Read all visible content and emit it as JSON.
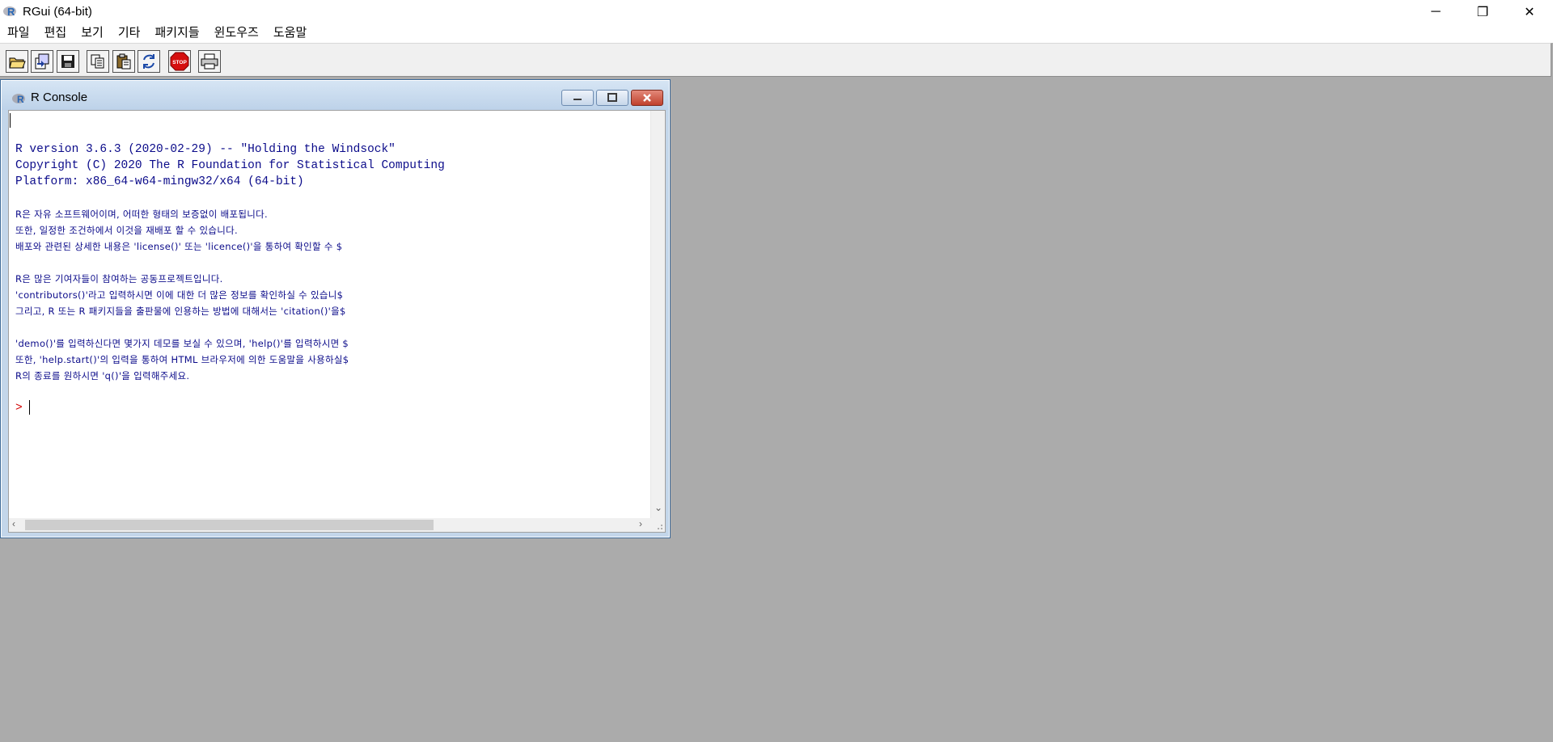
{
  "app": {
    "title": "RGui (64-bit)",
    "window_controls": {
      "minimize": "─",
      "restore": "❐",
      "close": "✕"
    }
  },
  "menu": [
    "파일",
    "편집",
    "보기",
    "기타",
    "패키지들",
    "윈도우즈",
    "도움말"
  ],
  "toolbar": {
    "buttons": [
      "open-script-icon",
      "load-workspace-icon",
      "save-workspace-icon",
      "copy-icon",
      "paste-icon",
      "copy-paste-icon",
      "stop-icon",
      "print-icon"
    ],
    "stop_label": "STOP"
  },
  "console": {
    "title": "R Console",
    "lines": [
      "R version 3.6.3 (2020-02-29) -- \"Holding the Windsock\"",
      "Copyright (C) 2020 The R Foundation for Statistical Computing",
      "Platform: x86_64-w64-mingw32/x64 (64-bit)",
      "R은 자유 소프트웨어이며, 어떠한 형태의 보증없이 배포됩니다.",
      "또한, 일정한 조건하에서 이것을 재배포 할 수 있습니다.",
      "배포와 관련된 상세한 내용은 'license()' 또는 'licence()'을 통하여 확인할 수 $",
      "R은 많은 기여자들이 참여하는 공동프로젝트입니다.",
      "'contributors()'라고 입력하시면 이에 대한 더 많은 정보를 확인하실 수 있습니$",
      "그리고, R 또는 R 패키지들을 출판물에 인용하는 방법에 대해서는 'citation()'을$",
      "'demo()'를 입력하신다면 몇가지 데모를 보실 수 있으며, 'help()'를 입력하시면 $",
      "또한, 'help.start()'의 입력을 통하여 HTML 브라우저에 의한 도움말을 사용하실$",
      "R의 종료를 원하시면 'q()'을 입력해주세요."
    ],
    "prompt": ">"
  },
  "colors": {
    "console_text": "#0b0b8a",
    "prompt": "#d20000",
    "mdi_background": "#ababab"
  }
}
